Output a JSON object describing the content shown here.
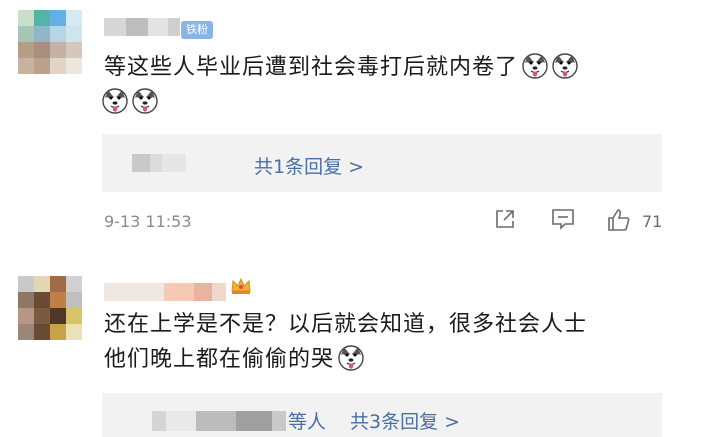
{
  "comments": [
    {
      "badge": "铁粉",
      "text_line1": "等这些人毕业后遭到社会毒打后就内卷了",
      "emojis_line1": [
        "doge-emoji",
        "doge-emoji"
      ],
      "emojis_line2": [
        "doge-emoji",
        "doge-emoji"
      ],
      "reply_summary": "共1条回复 >",
      "timestamp": "9-13 11:53",
      "actions": {
        "share_icon": "share-icon",
        "comment_icon": "comment-icon",
        "like_icon": "thumbs-up-icon",
        "like_count": "71"
      }
    },
    {
      "badge_icon": "crown-icon",
      "text_line1": "还在上学是不是？以后就会知道，很多社会人士",
      "text_line2": "他们晚上都在偷偷的哭",
      "emojis_line2": [
        "doge-emoji"
      ],
      "reply_prefix": "等人",
      "reply_summary": "共3条回复 >"
    }
  ],
  "colors": {
    "link": "#4a6fa5",
    "reply_bg": "#f2f2f2",
    "badge": "#8ab4e8",
    "meta": "#8a8a8a"
  }
}
